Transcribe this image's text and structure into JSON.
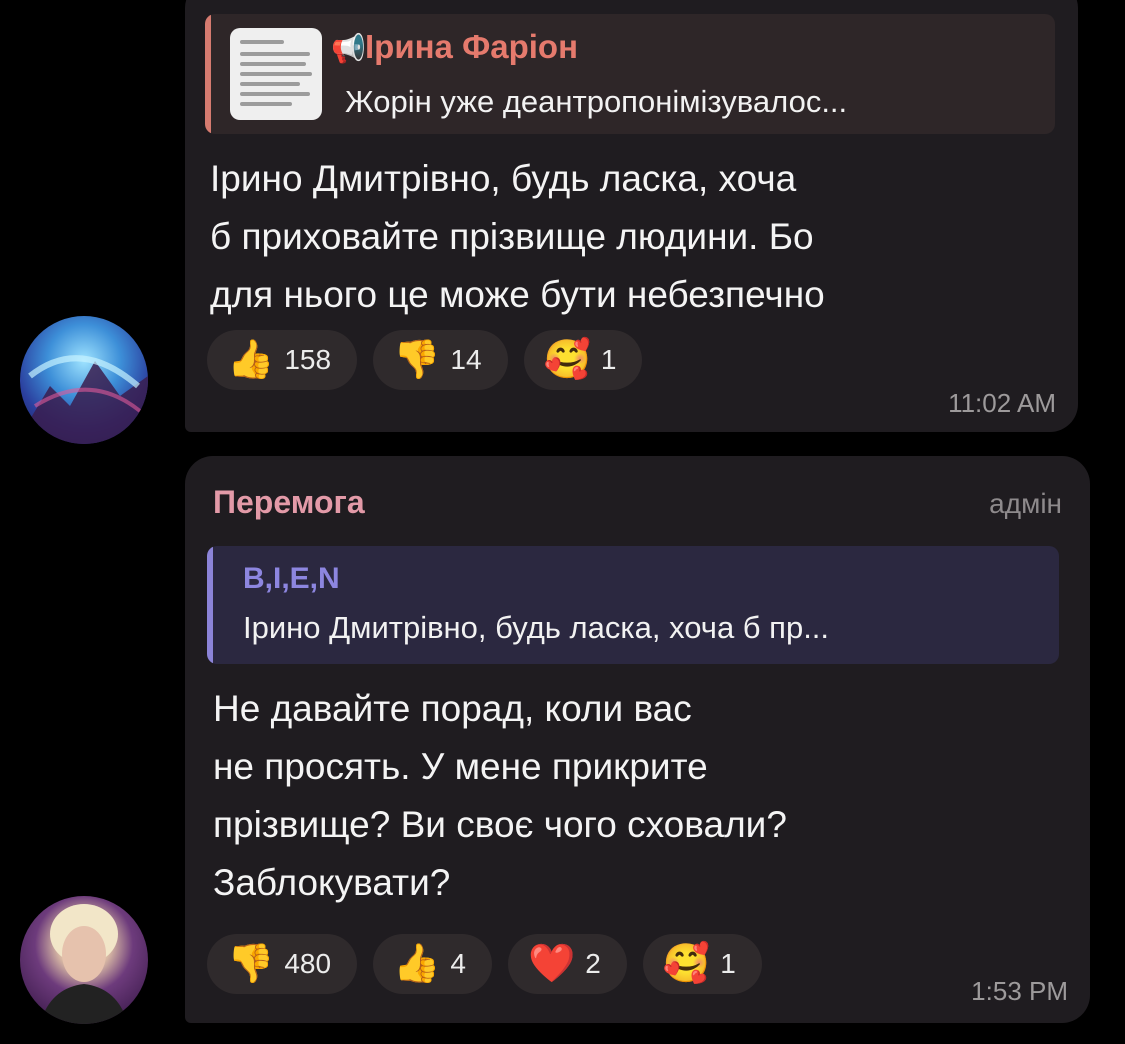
{
  "messages": [
    {
      "reply": {
        "author": "Ірина Фаріон",
        "text": "Жорін уже деантропонімізувалос..."
      },
      "text": "Ірино Дмитрівно,  будь ласка, хоча\nб приховайте  прізвище людини.  Бо\nдля нього це може бути небезпечно",
      "reactions": [
        {
          "icon": "thumbs-up-icon",
          "emoji": "👍",
          "count": "158"
        },
        {
          "icon": "thumbs-down-icon",
          "emoji": "👎",
          "count": "14"
        },
        {
          "icon": "smiling-face-with-hearts-icon",
          "emoji": "🥰",
          "count": "1"
        }
      ],
      "time": "11:02 AM"
    },
    {
      "sender": "Перемога",
      "badge": "адмін",
      "reply": {
        "author": "B,I,E,N",
        "text": "Ірино Дмитрівно,  будь ласка, хоча б пр..."
      },
      "text": "Не давайте порад, коли вас\nне просять. У мене прикрите\nпрізвище? Ви своє чого сховали?\nЗаблокувати?",
      "reactions": [
        {
          "icon": "thumbs-down-icon",
          "emoji": "👎",
          "count": "480"
        },
        {
          "icon": "thumbs-up-icon",
          "emoji": "👍",
          "count": "4"
        },
        {
          "icon": "heart-icon",
          "emoji": "❤️",
          "count": "2"
        },
        {
          "icon": "smiling-face-with-hearts-icon",
          "emoji": "🥰",
          "count": "1"
        }
      ],
      "time": "1:53 PM"
    }
  ],
  "colors": {
    "background": "#000000",
    "bubble": "#1f1c20",
    "reply1_accent": "#e57a6d",
    "reply2_accent": "#8d86e0",
    "sender_name": "#e39aa8",
    "reaction_pill": "#2f2a2c",
    "timestamp": "#9d9a9b"
  }
}
